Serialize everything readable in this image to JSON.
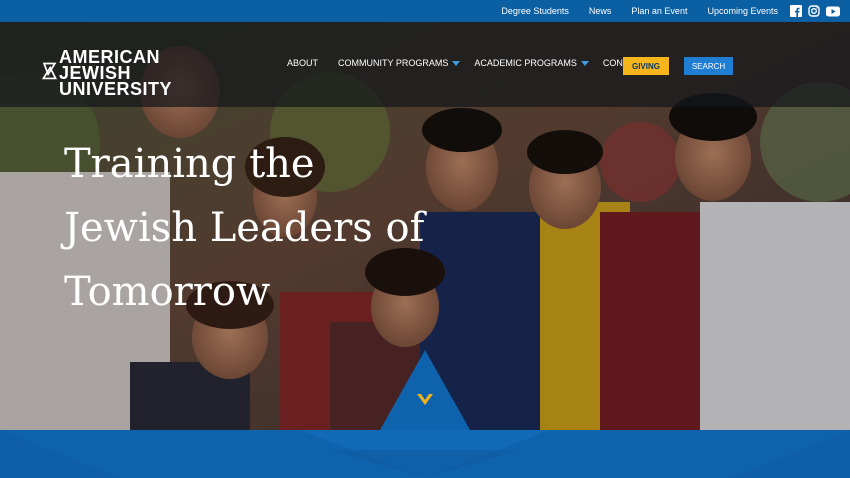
{
  "top_bar": {
    "links": [
      "Degree Students",
      "News",
      "Plan an Event",
      "Upcoming Events"
    ],
    "social_icons": [
      "facebook-icon",
      "instagram-icon",
      "youtube-icon"
    ]
  },
  "logo": {
    "line1": "AMERICAN",
    "line2": "JEWISH",
    "line3": "UNIVERSITY"
  },
  "nav": {
    "items": [
      {
        "label": "ABOUT"
      },
      {
        "label": "COMMUNITY PROGRAMS"
      },
      {
        "label": "ACADEMIC PROGRAMS"
      },
      {
        "label": "CONTACT"
      }
    ],
    "giving_label": "GIVING",
    "search_label": "SEARCH"
  },
  "hero": {
    "headline_lines": [
      "Training the",
      "Jewish Leaders of",
      "Tomorrow"
    ]
  },
  "colors": {
    "brand_blue": "#0b5fa3",
    "giving_yellow": "#f6b51a",
    "search_blue": "#1f7dd2",
    "chevron_gold": "#f2b21a"
  }
}
